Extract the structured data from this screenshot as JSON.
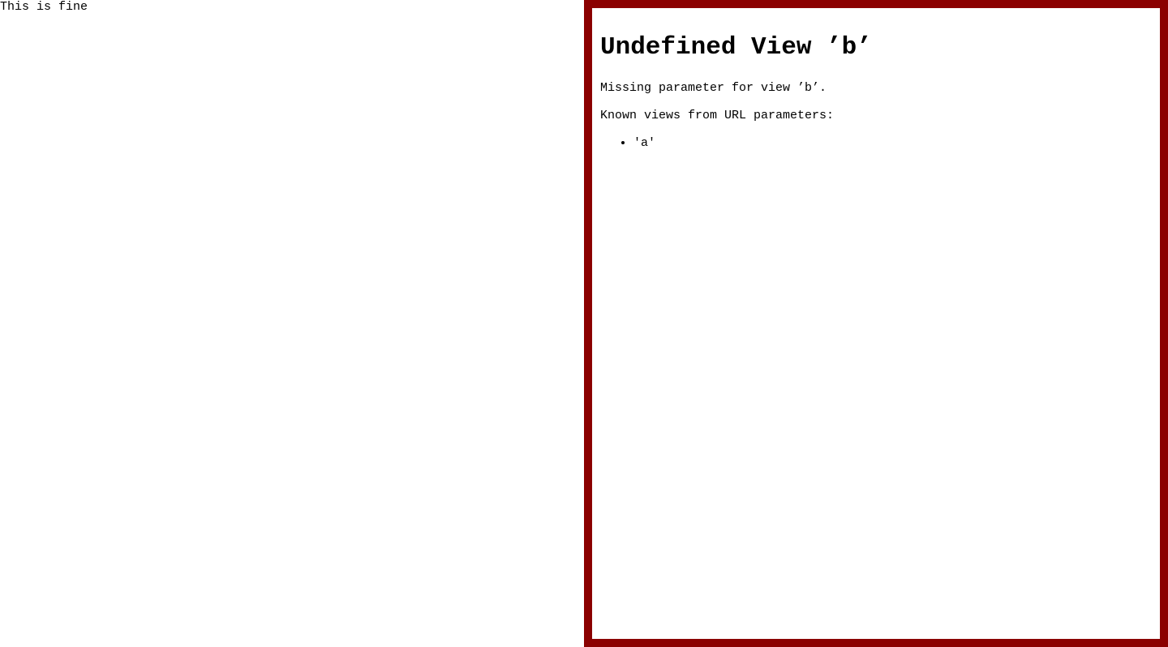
{
  "left_view": {
    "text": "This is fine"
  },
  "error_view": {
    "title": "Undefined View ’b’",
    "message": "Missing parameter for view ’b’.",
    "known_views_label": "Known views from URL parameters:",
    "known_views": [
      "'a'"
    ],
    "border_color": "#8b0000"
  }
}
